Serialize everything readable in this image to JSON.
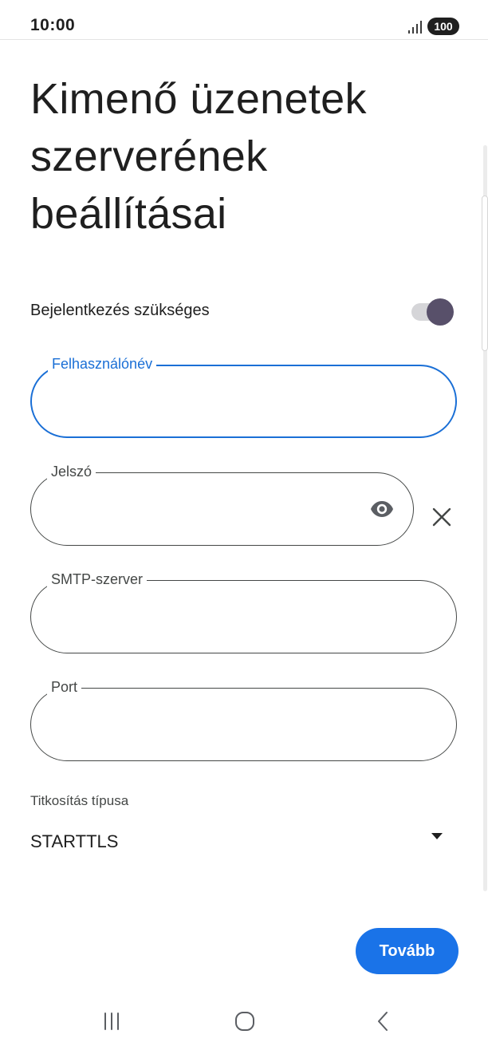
{
  "status_bar": {
    "time": "10:00",
    "battery": "100"
  },
  "page": {
    "title": "Kimenő üzenetek szerverének beállításai"
  },
  "login_required": {
    "label": "Bejelentkezés szükséges",
    "enabled": true
  },
  "fields": {
    "username": {
      "label": "Felhasználónév",
      "value": "",
      "focused": true
    },
    "password": {
      "label": "Jelszó",
      "value": ""
    },
    "smtp_server": {
      "label": "SMTP-szerver",
      "value": ""
    },
    "port": {
      "label": "Port",
      "value": ""
    }
  },
  "encryption": {
    "label": "Titkosítás típusa",
    "selected": "STARTTLS"
  },
  "actions": {
    "next_label": "Tovább"
  },
  "icons": {
    "password_visibility": "eye-icon",
    "clear_password": "close-icon",
    "dropdown": "dropdown-arrow-icon",
    "nav_recents": "recents-icon",
    "nav_home": "home-icon",
    "nav_back": "back-icon"
  },
  "colors": {
    "accent": "#1a73e8",
    "focused_outline": "#1a6fd6",
    "toggle_knob": "#58506a",
    "toggle_track": "#d5d5d8"
  }
}
